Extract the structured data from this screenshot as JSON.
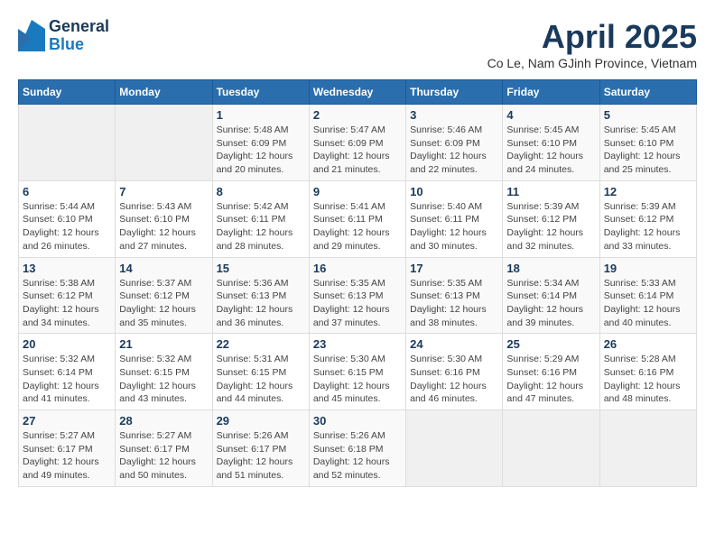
{
  "logo": {
    "general": "General",
    "blue": "Blue"
  },
  "title": "April 2025",
  "subtitle": "Co Le, Nam GJinh Province, Vietnam",
  "days_of_week": [
    "Sunday",
    "Monday",
    "Tuesday",
    "Wednesday",
    "Thursday",
    "Friday",
    "Saturday"
  ],
  "weeks": [
    [
      {
        "day": "",
        "sunrise": "",
        "sunset": "",
        "daylight": ""
      },
      {
        "day": "",
        "sunrise": "",
        "sunset": "",
        "daylight": ""
      },
      {
        "day": "1",
        "sunrise": "Sunrise: 5:48 AM",
        "sunset": "Sunset: 6:09 PM",
        "daylight": "Daylight: 12 hours and 20 minutes."
      },
      {
        "day": "2",
        "sunrise": "Sunrise: 5:47 AM",
        "sunset": "Sunset: 6:09 PM",
        "daylight": "Daylight: 12 hours and 21 minutes."
      },
      {
        "day": "3",
        "sunrise": "Sunrise: 5:46 AM",
        "sunset": "Sunset: 6:09 PM",
        "daylight": "Daylight: 12 hours and 22 minutes."
      },
      {
        "day": "4",
        "sunrise": "Sunrise: 5:45 AM",
        "sunset": "Sunset: 6:10 PM",
        "daylight": "Daylight: 12 hours and 24 minutes."
      },
      {
        "day": "5",
        "sunrise": "Sunrise: 5:45 AM",
        "sunset": "Sunset: 6:10 PM",
        "daylight": "Daylight: 12 hours and 25 minutes."
      }
    ],
    [
      {
        "day": "6",
        "sunrise": "Sunrise: 5:44 AM",
        "sunset": "Sunset: 6:10 PM",
        "daylight": "Daylight: 12 hours and 26 minutes."
      },
      {
        "day": "7",
        "sunrise": "Sunrise: 5:43 AM",
        "sunset": "Sunset: 6:10 PM",
        "daylight": "Daylight: 12 hours and 27 minutes."
      },
      {
        "day": "8",
        "sunrise": "Sunrise: 5:42 AM",
        "sunset": "Sunset: 6:11 PM",
        "daylight": "Daylight: 12 hours and 28 minutes."
      },
      {
        "day": "9",
        "sunrise": "Sunrise: 5:41 AM",
        "sunset": "Sunset: 6:11 PM",
        "daylight": "Daylight: 12 hours and 29 minutes."
      },
      {
        "day": "10",
        "sunrise": "Sunrise: 5:40 AM",
        "sunset": "Sunset: 6:11 PM",
        "daylight": "Daylight: 12 hours and 30 minutes."
      },
      {
        "day": "11",
        "sunrise": "Sunrise: 5:39 AM",
        "sunset": "Sunset: 6:12 PM",
        "daylight": "Daylight: 12 hours and 32 minutes."
      },
      {
        "day": "12",
        "sunrise": "Sunrise: 5:39 AM",
        "sunset": "Sunset: 6:12 PM",
        "daylight": "Daylight: 12 hours and 33 minutes."
      }
    ],
    [
      {
        "day": "13",
        "sunrise": "Sunrise: 5:38 AM",
        "sunset": "Sunset: 6:12 PM",
        "daylight": "Daylight: 12 hours and 34 minutes."
      },
      {
        "day": "14",
        "sunrise": "Sunrise: 5:37 AM",
        "sunset": "Sunset: 6:12 PM",
        "daylight": "Daylight: 12 hours and 35 minutes."
      },
      {
        "day": "15",
        "sunrise": "Sunrise: 5:36 AM",
        "sunset": "Sunset: 6:13 PM",
        "daylight": "Daylight: 12 hours and 36 minutes."
      },
      {
        "day": "16",
        "sunrise": "Sunrise: 5:35 AM",
        "sunset": "Sunset: 6:13 PM",
        "daylight": "Daylight: 12 hours and 37 minutes."
      },
      {
        "day": "17",
        "sunrise": "Sunrise: 5:35 AM",
        "sunset": "Sunset: 6:13 PM",
        "daylight": "Daylight: 12 hours and 38 minutes."
      },
      {
        "day": "18",
        "sunrise": "Sunrise: 5:34 AM",
        "sunset": "Sunset: 6:14 PM",
        "daylight": "Daylight: 12 hours and 39 minutes."
      },
      {
        "day": "19",
        "sunrise": "Sunrise: 5:33 AM",
        "sunset": "Sunset: 6:14 PM",
        "daylight": "Daylight: 12 hours and 40 minutes."
      }
    ],
    [
      {
        "day": "20",
        "sunrise": "Sunrise: 5:32 AM",
        "sunset": "Sunset: 6:14 PM",
        "daylight": "Daylight: 12 hours and 41 minutes."
      },
      {
        "day": "21",
        "sunrise": "Sunrise: 5:32 AM",
        "sunset": "Sunset: 6:15 PM",
        "daylight": "Daylight: 12 hours and 43 minutes."
      },
      {
        "day": "22",
        "sunrise": "Sunrise: 5:31 AM",
        "sunset": "Sunset: 6:15 PM",
        "daylight": "Daylight: 12 hours and 44 minutes."
      },
      {
        "day": "23",
        "sunrise": "Sunrise: 5:30 AM",
        "sunset": "Sunset: 6:15 PM",
        "daylight": "Daylight: 12 hours and 45 minutes."
      },
      {
        "day": "24",
        "sunrise": "Sunrise: 5:30 AM",
        "sunset": "Sunset: 6:16 PM",
        "daylight": "Daylight: 12 hours and 46 minutes."
      },
      {
        "day": "25",
        "sunrise": "Sunrise: 5:29 AM",
        "sunset": "Sunset: 6:16 PM",
        "daylight": "Daylight: 12 hours and 47 minutes."
      },
      {
        "day": "26",
        "sunrise": "Sunrise: 5:28 AM",
        "sunset": "Sunset: 6:16 PM",
        "daylight": "Daylight: 12 hours and 48 minutes."
      }
    ],
    [
      {
        "day": "27",
        "sunrise": "Sunrise: 5:27 AM",
        "sunset": "Sunset: 6:17 PM",
        "daylight": "Daylight: 12 hours and 49 minutes."
      },
      {
        "day": "28",
        "sunrise": "Sunrise: 5:27 AM",
        "sunset": "Sunset: 6:17 PM",
        "daylight": "Daylight: 12 hours and 50 minutes."
      },
      {
        "day": "29",
        "sunrise": "Sunrise: 5:26 AM",
        "sunset": "Sunset: 6:17 PM",
        "daylight": "Daylight: 12 hours and 51 minutes."
      },
      {
        "day": "30",
        "sunrise": "Sunrise: 5:26 AM",
        "sunset": "Sunset: 6:18 PM",
        "daylight": "Daylight: 12 hours and 52 minutes."
      },
      {
        "day": "",
        "sunrise": "",
        "sunset": "",
        "daylight": ""
      },
      {
        "day": "",
        "sunrise": "",
        "sunset": "",
        "daylight": ""
      },
      {
        "day": "",
        "sunrise": "",
        "sunset": "",
        "daylight": ""
      }
    ]
  ]
}
